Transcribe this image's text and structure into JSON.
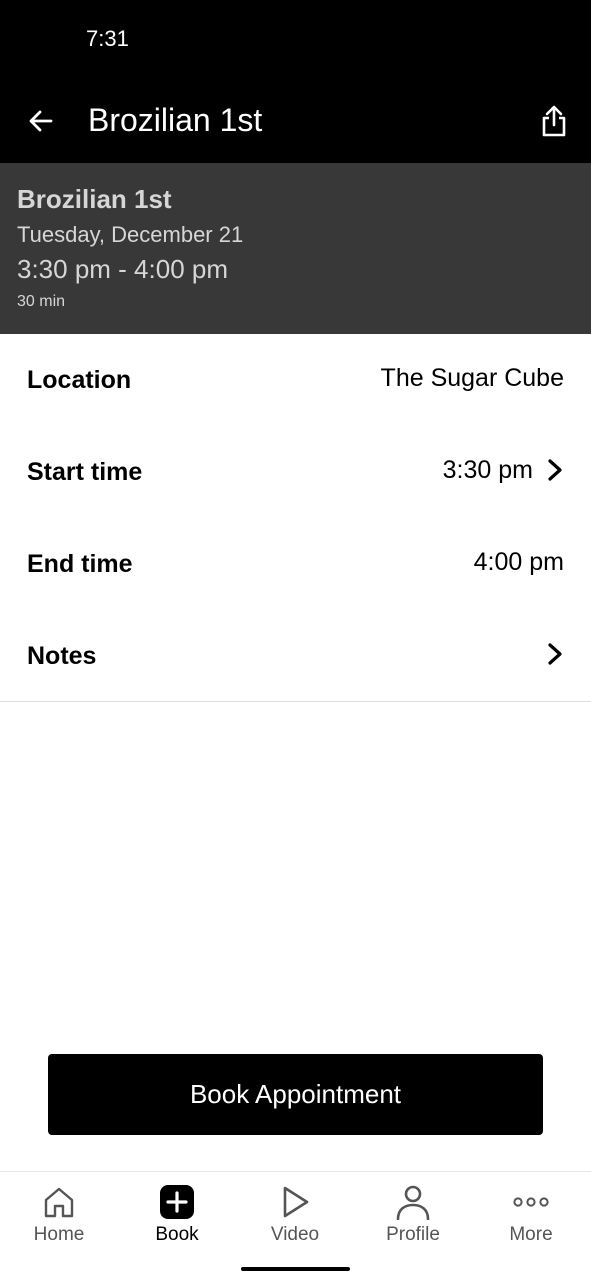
{
  "status_bar": {
    "time": "7:31"
  },
  "app_bar": {
    "title": "Brozilian 1st",
    "back_icon": "arrow-left-icon",
    "share_icon": "share-icon"
  },
  "summary": {
    "title": "Brozilian 1st",
    "date": "Tuesday, December 21",
    "time_range": "3:30 pm - 4:00 pm",
    "duration": "30 min"
  },
  "details": {
    "location": {
      "label": "Location",
      "value": "The Sugar Cube"
    },
    "start_time": {
      "label": "Start time",
      "value": "3:30 pm"
    },
    "end_time": {
      "label": "End time",
      "value": "4:00 pm"
    },
    "notes": {
      "label": "Notes"
    }
  },
  "book_button": {
    "label": "Book Appointment"
  },
  "bottom_nav": {
    "items": [
      {
        "label": "Home",
        "icon": "home-icon",
        "active": false
      },
      {
        "label": "Book",
        "icon": "plus-square-icon",
        "active": true
      },
      {
        "label": "Video",
        "icon": "play-icon",
        "active": false
      },
      {
        "label": "Profile",
        "icon": "person-icon",
        "active": false
      },
      {
        "label": "More",
        "icon": "more-dots-icon",
        "active": false
      }
    ]
  },
  "colors": {
    "app_bar_bg": "#000000",
    "summary_bg": "#383838",
    "summary_text": "#d6d6d6",
    "primary_button": "#000000"
  }
}
